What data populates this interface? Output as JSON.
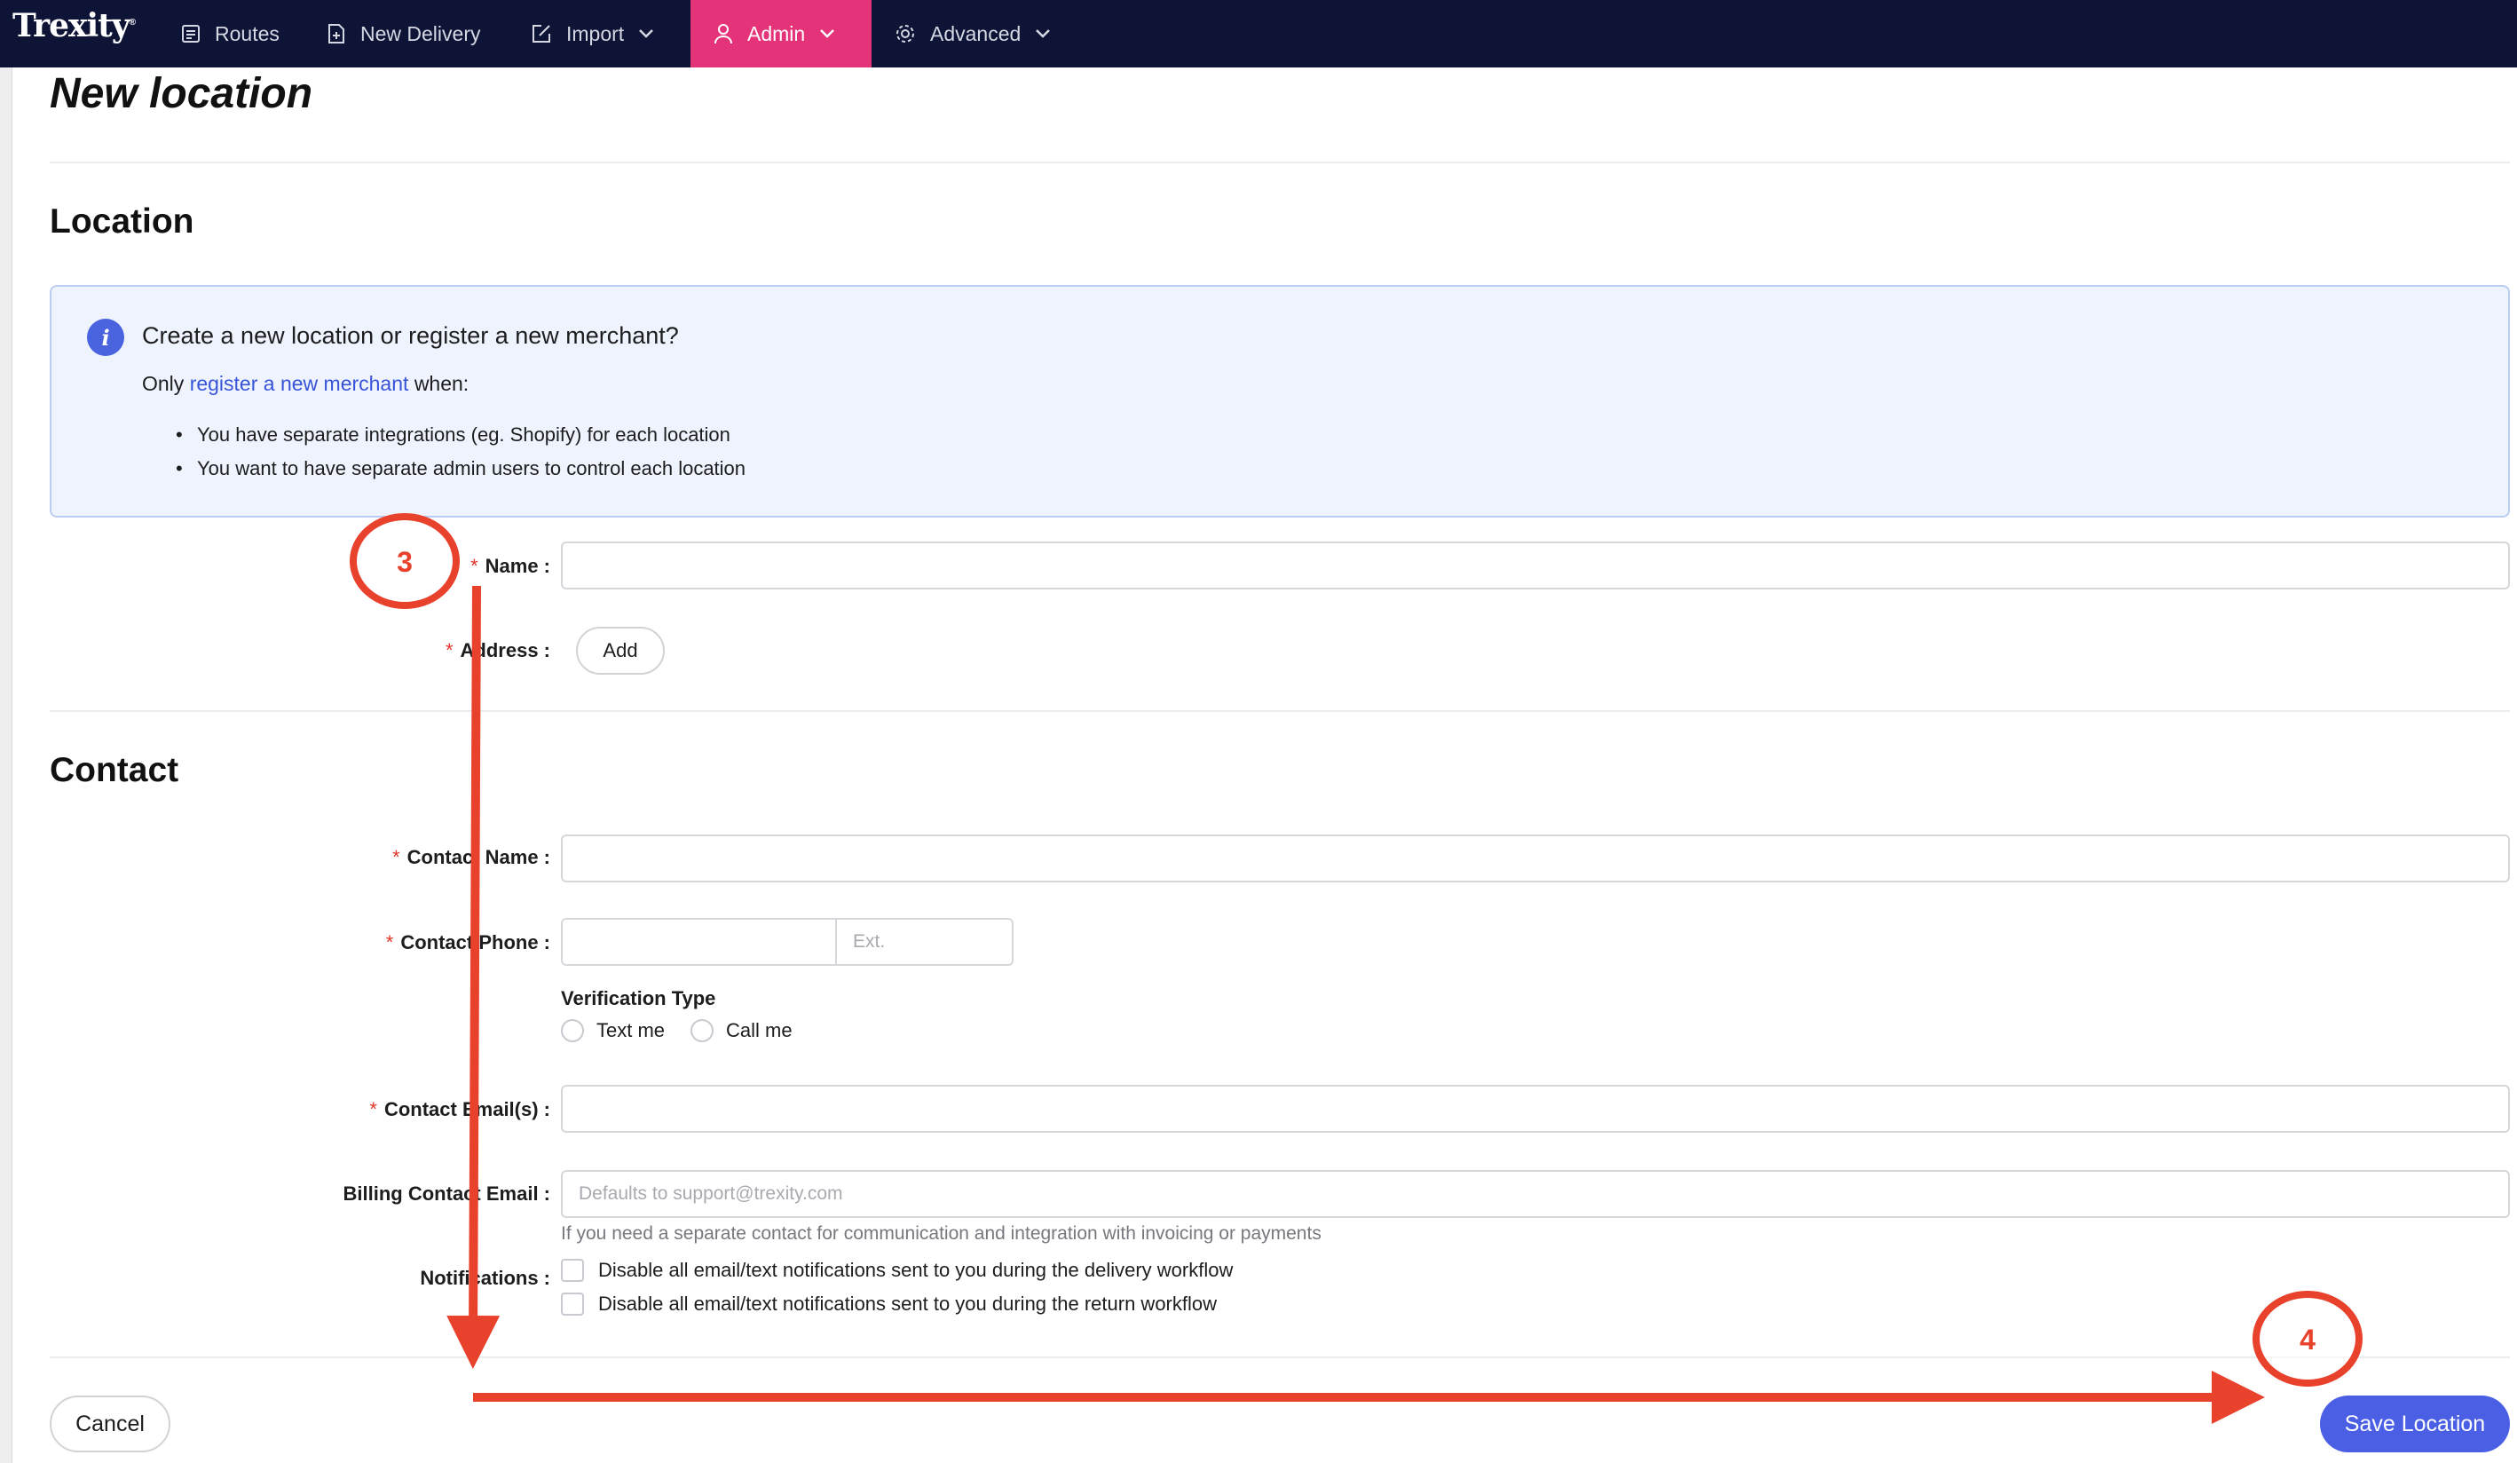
{
  "nav": {
    "logo": "Trexity",
    "items": [
      {
        "label": "Routes",
        "icon": "list-icon"
      },
      {
        "label": "New Delivery",
        "icon": "document-plus-icon"
      },
      {
        "label": "Import",
        "icon": "edit-icon"
      },
      {
        "label": "Admin",
        "icon": "user-icon",
        "active": true
      },
      {
        "label": "Advanced",
        "icon": "gear-icon"
      }
    ]
  },
  "page": {
    "title": "New location"
  },
  "location": {
    "title": "Location",
    "info": {
      "title": "Create a new location or register a new merchant?",
      "only_prefix": "Only",
      "link": "register a new merchant",
      "only_suffix": "when:",
      "bullets": [
        "You have separate integrations (eg. Shopify) for each location",
        "You want to have separate admin users to control each location"
      ]
    },
    "name_label": "Name :",
    "name_value": "",
    "address_label": "Address :",
    "add_button": "Add"
  },
  "contact": {
    "title": "Contact",
    "name_label": "Contact Name :",
    "phone_label": "Contact Phone :",
    "ext_placeholder": "Ext.",
    "verification_title": "Verification Type",
    "verification_options": [
      "Text me",
      "Call me"
    ],
    "email_label": "Contact Email(s) :",
    "billing_label": "Billing Contact Email :",
    "billing_placeholder": "Defaults to support@trexity.com",
    "billing_hint": "If you need a separate contact for communication and integration with invoicing or payments",
    "notifications_label": "Notifications :",
    "notifications": [
      "Disable all email/text notifications sent to you during the delivery workflow",
      "Disable all email/text notifications sent to you during the return workflow"
    ]
  },
  "footer": {
    "cancel": "Cancel",
    "save": "Save Location"
  },
  "annotations": {
    "step_a": "3",
    "step_b": "4",
    "color": "#e8412c"
  },
  "colors": {
    "nav_bg": "#0e1435",
    "nav_active": "#e5337a",
    "primary": "#4a5fe3",
    "link": "#3753d8",
    "info_bg": "#eef3fd"
  }
}
